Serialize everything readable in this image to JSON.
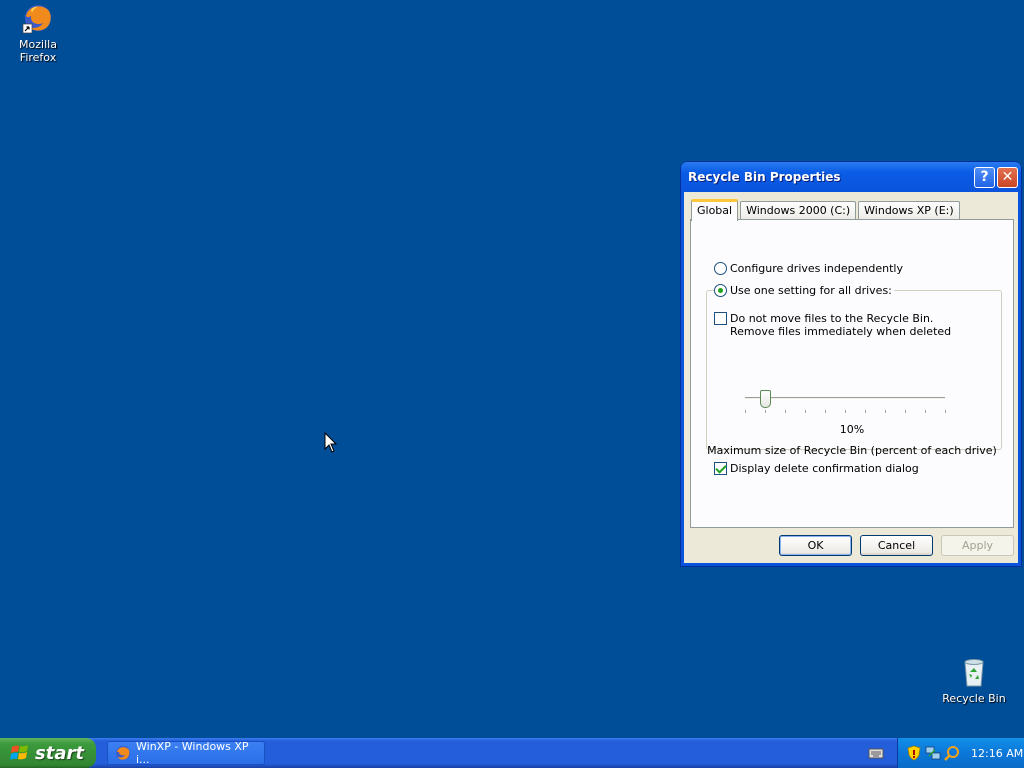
{
  "desktop": {
    "icons": [
      {
        "label": "Mozilla Firefox",
        "icon": "firefox-shortcut-icon"
      },
      {
        "label": "Recycle Bin",
        "icon": "recycle-bin-icon"
      }
    ],
    "background_color": "#004e98"
  },
  "dialog": {
    "title": "Recycle Bin Properties",
    "help_label": "?",
    "close_label": "✕",
    "tabs": [
      {
        "label": "Global",
        "active": true
      },
      {
        "label": "Windows 2000 (C:)",
        "active": false
      },
      {
        "label": "Windows XP (E:)",
        "active": false
      }
    ],
    "options": {
      "configure_independently": {
        "label": "Configure drives independently",
        "selected": false
      },
      "use_one_setting": {
        "label": "Use one setting for all drives:",
        "selected": true
      },
      "do_not_move": {
        "line1": "Do not move files to the Recycle Bin.",
        "line2": "Remove files immediately when deleted",
        "checked": false
      },
      "slider": {
        "value_percent": 10,
        "label": "10%",
        "max_label": "Maximum size of Recycle Bin (percent of each drive)"
      },
      "display_confirmation": {
        "label": "Display delete confirmation dialog",
        "checked": true
      }
    },
    "buttons": {
      "ok": "OK",
      "cancel": "Cancel",
      "apply": "Apply"
    }
  },
  "taskbar": {
    "start_label": "start",
    "task_label": "WinXP - Windows XP i...",
    "clock": "12:16 AM",
    "tray_icons": [
      "security-shield-icon",
      "network-icon",
      "search-icon"
    ]
  }
}
